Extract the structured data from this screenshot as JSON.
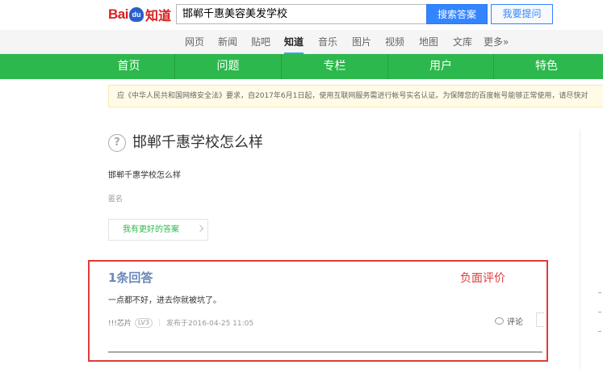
{
  "header": {
    "logo_bai": "Bai",
    "logo_du": "du",
    "logo_zhidao": "知道",
    "search_value": "邯郸千惠美容美发学校",
    "search_button": "搜索答案",
    "ask_button": "我要提问"
  },
  "subnav": [
    "网页",
    "新闻",
    "贴吧",
    "知道",
    "音乐",
    "图片",
    "视频",
    "地图",
    "文库",
    "更多»"
  ],
  "subnav_active": "知道",
  "greennav": [
    "首页",
    "问题",
    "专栏",
    "用户",
    "特色"
  ],
  "notice": "应《中华人民共和国网络安全法》要求，自2017年6月1日起，使用互联网服务需进行帐号实名认证。为保障您的百度帐号能够正常使用，请尽快对",
  "question": {
    "icon": "?",
    "title": "邯郸千惠学校怎么样",
    "description": "邯郸千惠学校怎么样",
    "asker": "匿名",
    "better_answer_button": "我有更好的答案"
  },
  "answer": {
    "count_label": "1条回答",
    "annotation": "负面评价",
    "text": "一点都不好，进去你就被坑了。",
    "user": "!!!芯片",
    "level": "LV3",
    "posted": "发布于2016-04-25 11:05",
    "comment_label": "评论"
  },
  "colors": {
    "green_nav": "#2db84d",
    "search_blue": "#3385ff",
    "highlight_red": "#e03a3a",
    "logo_red": "#d8201e"
  }
}
